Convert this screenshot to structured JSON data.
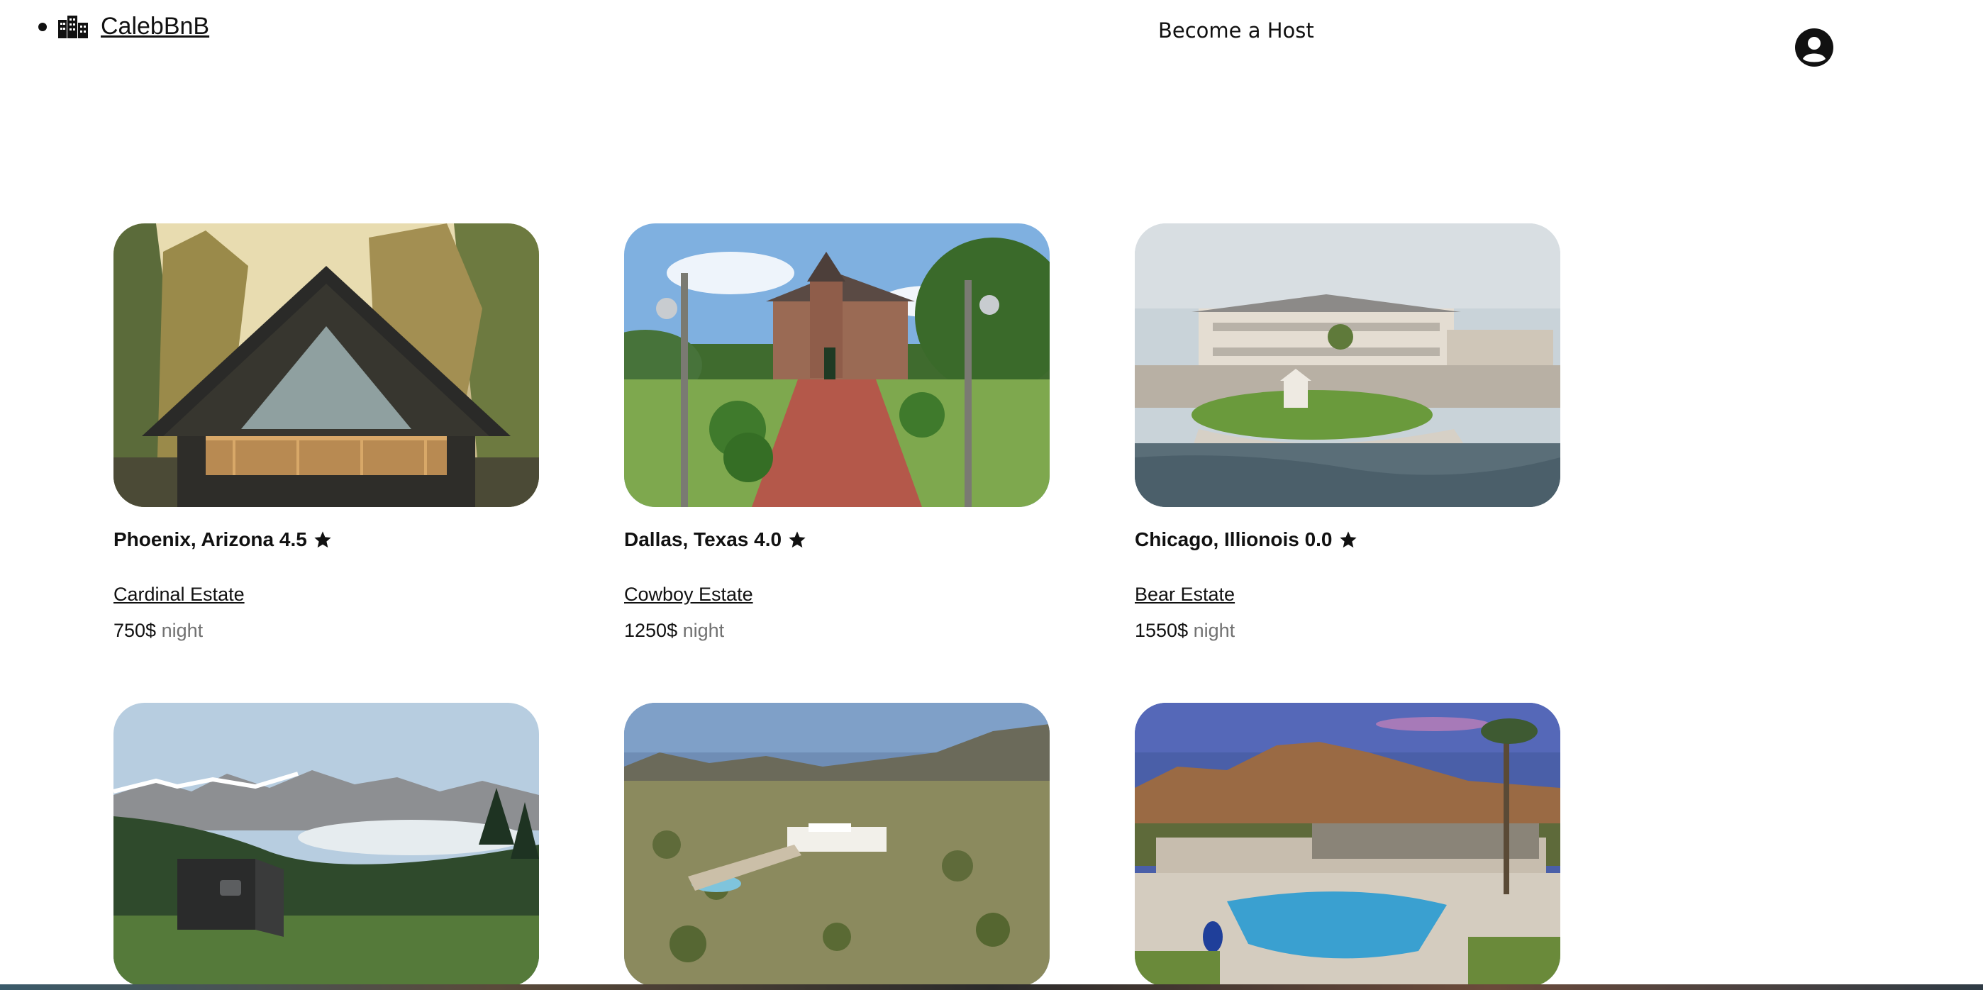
{
  "nav": {
    "brand_name": "CalebBnB",
    "host_label": "Become a Host"
  },
  "listings": [
    {
      "location": "Phoenix, Arizona",
      "rating": "4.5",
      "name": "Cardinal Estate",
      "price": "750$",
      "unit": "night"
    },
    {
      "location": "Dallas, Texas",
      "rating": "4.0",
      "name": "Cowboy Estate",
      "price": "1250$",
      "unit": "night"
    },
    {
      "location": "Chicago, Illionois",
      "rating": "0.0",
      "name": "Bear Estate",
      "price": "1550$",
      "unit": "night"
    },
    {
      "location": "",
      "rating": "",
      "name": "",
      "price": "",
      "unit": ""
    },
    {
      "location": "",
      "rating": "",
      "name": "",
      "price": "",
      "unit": ""
    },
    {
      "location": "",
      "rating": "",
      "name": "",
      "price": "",
      "unit": ""
    }
  ],
  "icons": {
    "brand": "city-buildings-icon",
    "avatar": "user-circle-icon",
    "rating": "star-icon"
  }
}
